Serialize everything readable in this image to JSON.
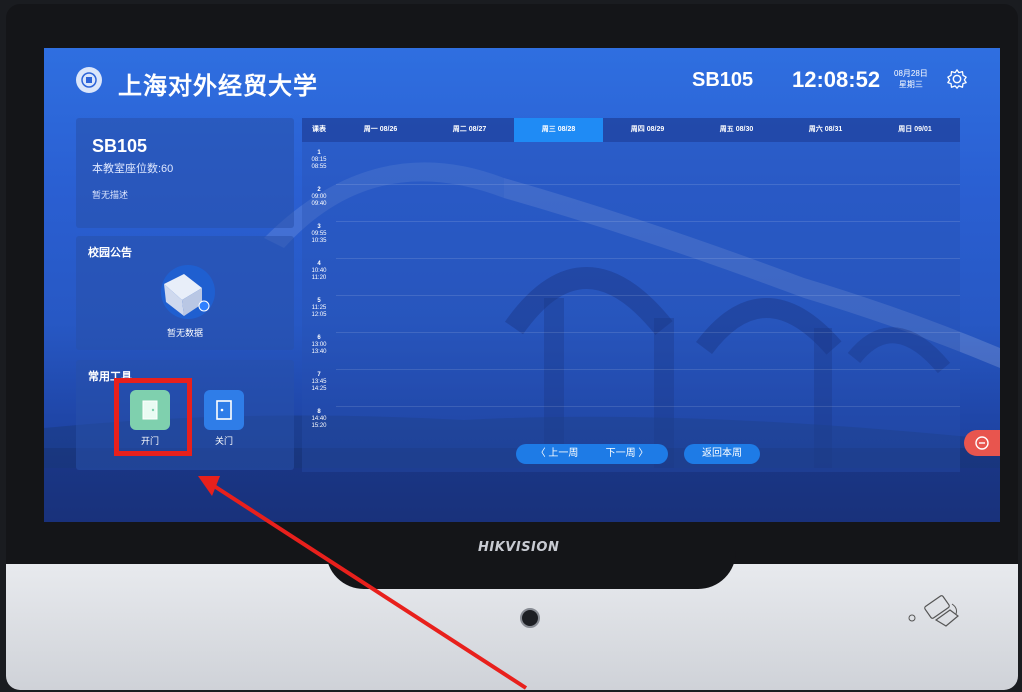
{
  "header": {
    "university": "上海对外经贸大学",
    "room": "SB105",
    "time": "12:08:52",
    "date_line1": "08月28日",
    "date_line2": "星期三",
    "settings_icon": "gear-icon"
  },
  "room_panel": {
    "name": "SB105",
    "seats": "本教室座位数:60",
    "description": "暂无描述"
  },
  "announce_panel": {
    "title": "校园公告",
    "empty_text": "暂无数据",
    "empty_icon": "empty-box-icon"
  },
  "tools_panel": {
    "title": "常用工具",
    "tools": [
      {
        "label": "开门",
        "icon": "door-open-icon",
        "color": "#7fd0ae"
      },
      {
        "label": "关门",
        "icon": "door-close-icon",
        "color": "#2f7de8"
      }
    ]
  },
  "schedule": {
    "header_label": "课表",
    "days": [
      "周一 08/26",
      "周二 08/27",
      "周三 08/28",
      "周四 08/29",
      "周五 08/30",
      "周六 08/31",
      "周日 09/01"
    ],
    "selected_day": "周三 08/28",
    "slots": [
      {
        "n": "1",
        "start": "08:15",
        "end": "08:55"
      },
      {
        "n": "2",
        "start": "09:00",
        "end": "09:40"
      },
      {
        "n": "3",
        "start": "09:55",
        "end": "10:35"
      },
      {
        "n": "4",
        "start": "10:40",
        "end": "11:20"
      },
      {
        "n": "5",
        "start": "11:25",
        "end": "12:05"
      },
      {
        "n": "6",
        "start": "13:00",
        "end": "13:40"
      },
      {
        "n": "7",
        "start": "13:45",
        "end": "14:25"
      },
      {
        "n": "8",
        "start": "14:40",
        "end": "15:20"
      }
    ],
    "nav": {
      "prev": "〈 上一周",
      "next": "下一周 〉",
      "back": "返回本周"
    }
  },
  "device": {
    "brand": "HIKVISION",
    "highlight_color": "#e8201c"
  }
}
